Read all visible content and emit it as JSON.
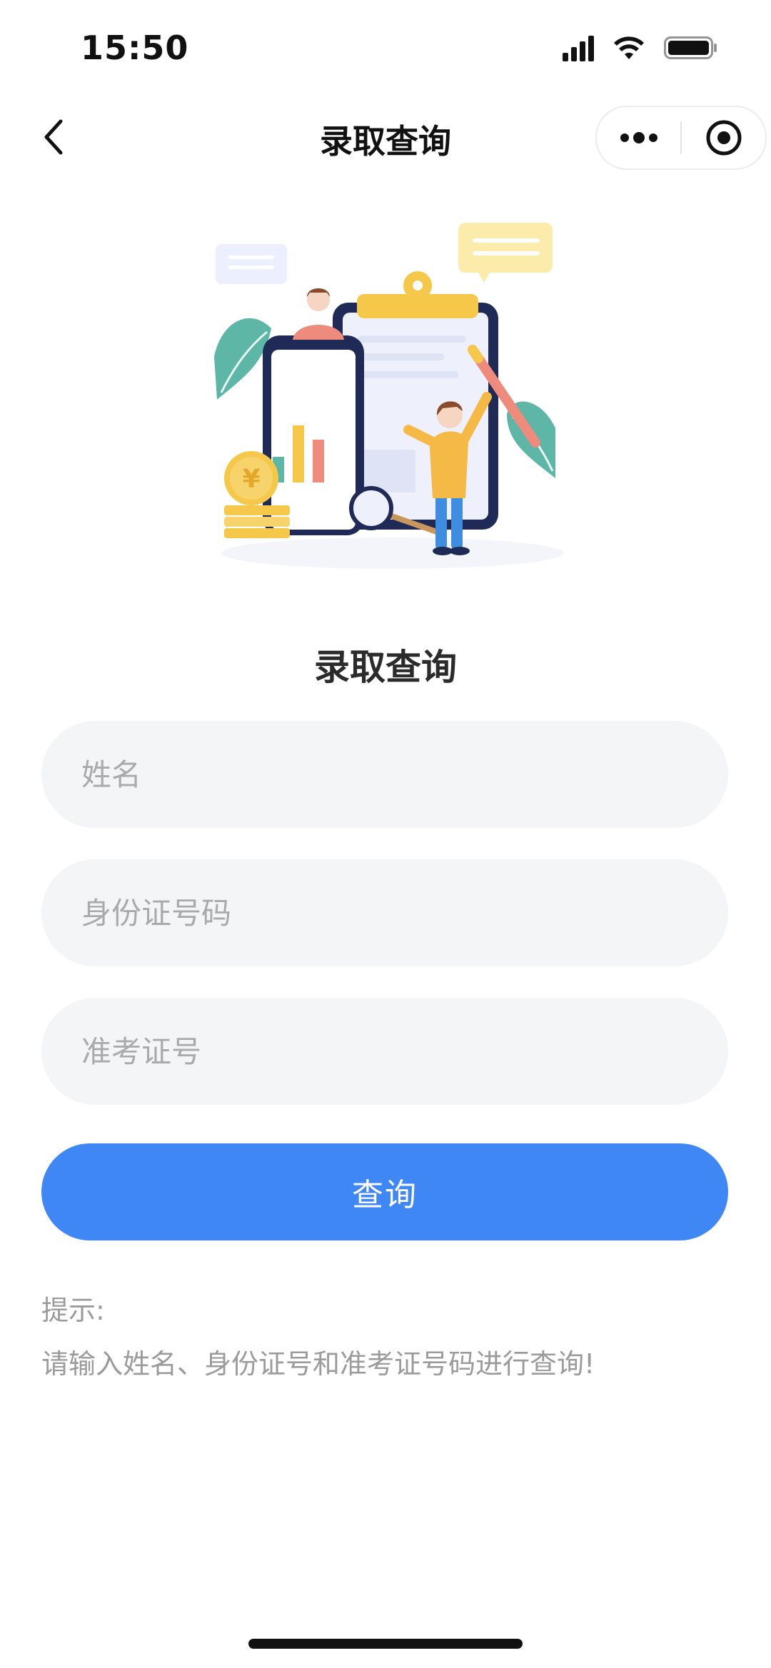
{
  "status_bar": {
    "time": "15:50"
  },
  "nav": {
    "title": "录取查询",
    "back_icon": "chevron-left-icon",
    "more_icon": "more-dots-icon",
    "close_icon": "target-circle-icon"
  },
  "illustration": {
    "icon": "clipboard-phone-illustration",
    "coin_symbol": "¥"
  },
  "form": {
    "title": "录取查询",
    "name_placeholder": "姓名",
    "id_placeholder": "身份证号码",
    "exam_placeholder": "准考证号",
    "submit_label": "查询"
  },
  "hint": {
    "title": "提示:",
    "text": "请输入姓名、身份证号和准考证号码进行查询!"
  },
  "colors": {
    "primary": "#3f87f5",
    "field_bg": "#f4f5f7",
    "hint_text": "#9b9b9b"
  }
}
